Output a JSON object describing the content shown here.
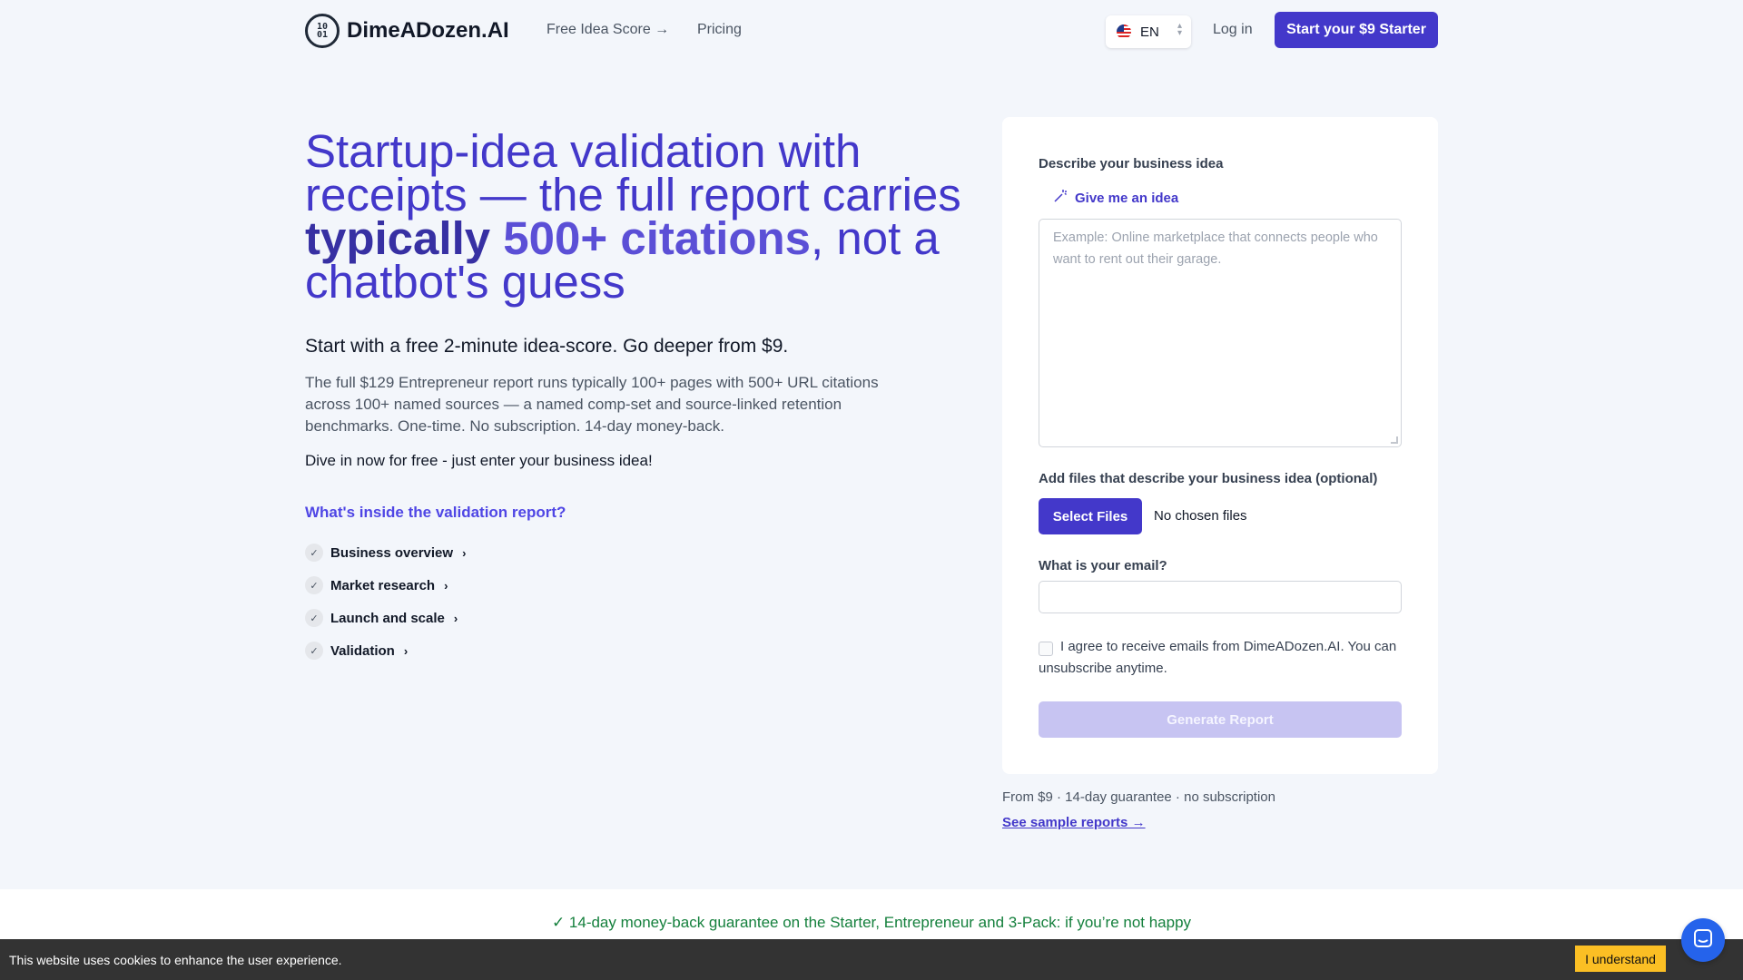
{
  "header": {
    "brand": "DimeADozen.AI",
    "logo_mark": "10 01",
    "nav": {
      "free_idea_score": "Free Idea Score →",
      "pricing": "Pricing"
    },
    "language": "EN",
    "login": "Log in",
    "cta": "Start your $9 Starter"
  },
  "hero": {
    "title_part1": "Startup-idea validation with receipts — the full report carries ",
    "title_strong": "typically ",
    "title_grad": "500+ citations",
    "title_part2": ", not a chatbot's guess",
    "subtitle": "Start with a free 2-minute idea-score. Go deeper from $9.",
    "description": "The full $129 Entrepreneur report runs typically 100+ pages with 500+ URL citations across 100+ named sources — a named comp-set and source-linked retention benchmarks. One-time. No subscription. 14-day money-back.",
    "dive": "Dive in now for free - just enter your business idea!",
    "inside_title": "What's inside the validation report?",
    "report_items": [
      {
        "label": "Business overview"
      },
      {
        "label": "Market research"
      },
      {
        "label": "Launch and scale"
      },
      {
        "label": "Validation"
      }
    ]
  },
  "form": {
    "idea_label": "Describe your business idea",
    "give_idea": "Give me an idea",
    "idea_placeholder": "Example: Online marketplace that connects people who want to rent out their garage.",
    "files_label": "Add files that describe your business idea (optional)",
    "select_files": "Select Files",
    "no_files": "No chosen files",
    "email_label": "What is your email?",
    "email_value": "",
    "consent": "I agree to receive emails from DimeADozen.AI. You can unsubscribe anytime.",
    "generate": "Generate Report"
  },
  "below_card": {
    "note": "From $9 · 14-day guarantee · no subscription",
    "sample_link": "See sample reports →"
  },
  "guarantee": "✓ 14-day money-back guarantee on the Starter, Entrepreneur and 3-Pack: if you’re not happy",
  "cookie": {
    "text": "This website uses cookies to enhance the user experience.",
    "button": "I understand"
  },
  "colors": {
    "brand": "#4338ca",
    "accent_text": "#4f46e5",
    "guarantee_green": "#15803d",
    "cookie_button": "#fbbf24",
    "chat": "#2563eb"
  }
}
